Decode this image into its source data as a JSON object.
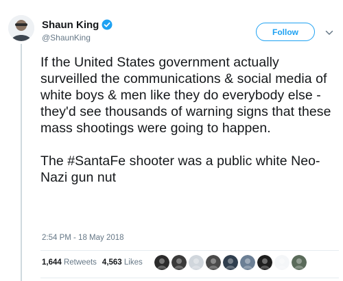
{
  "author": {
    "display_name": "Shaun King",
    "handle": "@ShaunKing",
    "avatar_icon": "user-avatar-icon",
    "verified_icon": "verified-badge-icon"
  },
  "follow_button": {
    "label": "Follow"
  },
  "menu_icon": "chevron-down-icon",
  "tweet": {
    "paragraph_1": "If the United States government actually surveilled the communications & social media of white boys & men like they do everybody else - they'd see thousands of warning signs that these mass shootings were going to happen.",
    "paragraph_2": "The #SantaFe shooter was a public white Neo-Nazi gun nut",
    "timestamp": "2:54 PM - 18 May 2018"
  },
  "stats": {
    "retweets_count": "1,644",
    "retweets_label": "Retweets",
    "likes_count": "4,563",
    "likes_label": "Likes"
  },
  "likers": [
    {
      "icon": "liker-avatar-icon",
      "color": "#2b2b2b"
    },
    {
      "icon": "liker-avatar-icon",
      "color": "#3a3a3a"
    },
    {
      "icon": "liker-avatar-icon",
      "color": "#d0d6dc"
    },
    {
      "icon": "liker-avatar-icon",
      "color": "#4a4a4a"
    },
    {
      "icon": "liker-avatar-icon",
      "color": "#2f3e4e"
    },
    {
      "icon": "liker-avatar-icon",
      "color": "#6b7f95"
    },
    {
      "icon": "liker-avatar-icon",
      "color": "#1e1e1e"
    },
    {
      "icon": "liker-avatar-icon",
      "color": "#f4f6f8"
    },
    {
      "icon": "liker-avatar-icon",
      "color": "#5a6b5a"
    }
  ],
  "colors": {
    "accent": "#1da1f2",
    "muted": "#657786",
    "text": "#14171a"
  }
}
